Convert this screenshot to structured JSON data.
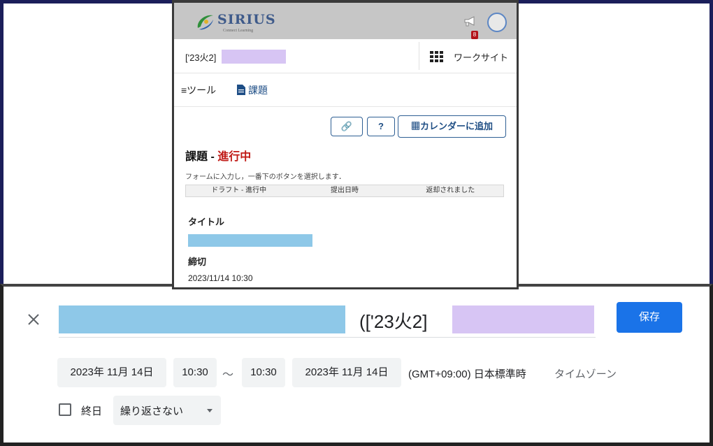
{
  "lms": {
    "logo_text": "SIRIUS",
    "logo_sub": "Connect Learning",
    "notification_count": "8",
    "site_name": "['23火2]",
    "worksite_label": "ワークサイト",
    "tools_label": "≡ツール",
    "assignments_label": "課題",
    "link_button": "🔗",
    "help_button": "?",
    "add_calendar_button": "▦カレンダーに追加",
    "heading_prefix": "課題 - ",
    "heading_status": "進行中",
    "instructions": "フォームに入力し，一番下のボタンを選択します．",
    "progress_steps": [
      "ドラフト - 進行中",
      "提出日時",
      "返却されました"
    ],
    "title_label": "タイトル",
    "deadline_label": "締切",
    "deadline_value": "2023/11/14 10:30"
  },
  "event_editor": {
    "title_text": "(['23火2]",
    "save_label": "保存",
    "start_date": "2023年 11月 14日",
    "start_time": "10:30",
    "range_separator": "〜",
    "end_time": "10:30",
    "end_date": "2023年 11月 14日",
    "timezone": "(GMT+09:00) 日本標準時",
    "timezone_link": "タイムゾーン",
    "all_day_label": "終日",
    "all_day_checked": false,
    "repeat_value": "繰り返さない"
  },
  "colors": {
    "frame": "#1b1f5a",
    "lms_header": "#c6c6c6",
    "lms_status_red": "#c01a16",
    "save_blue": "#1a73e8",
    "redaction_blue": "#8ec8e8",
    "redaction_purple": "#d7c5f4"
  }
}
